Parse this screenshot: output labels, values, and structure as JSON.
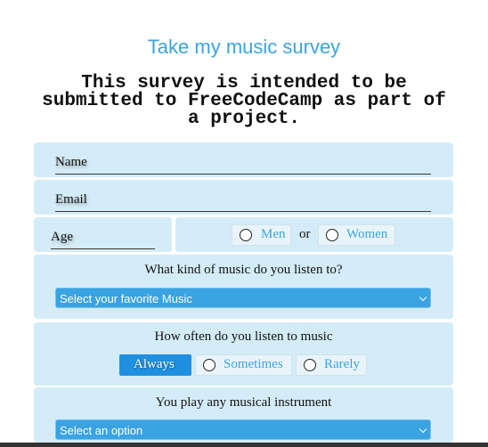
{
  "header": {
    "title": "Take my music survey",
    "subtitle": "This survey is intended to be submitted to FreeCodeCamp as part of a project."
  },
  "form": {
    "name_placeholder": "Name",
    "email_placeholder": "Email",
    "age_placeholder": "Age",
    "gender": {
      "option_men": "Men",
      "separator": "or",
      "option_women": "Women"
    },
    "music_question": "What kind of music do you listen to?",
    "music_select": "Select your favorite Music",
    "frequency_question": "How often do you listen to music",
    "frequency": {
      "always": "Always",
      "sometimes": "Sometimes",
      "rarely": "Rarely",
      "selected": "Always"
    },
    "instrument_question": "You play any musical instrument",
    "instrument_select": "Select an option"
  },
  "colors": {
    "accent": "#3aa3e2",
    "panel": "#d4ecf7",
    "selected": "#1f8fe0"
  }
}
